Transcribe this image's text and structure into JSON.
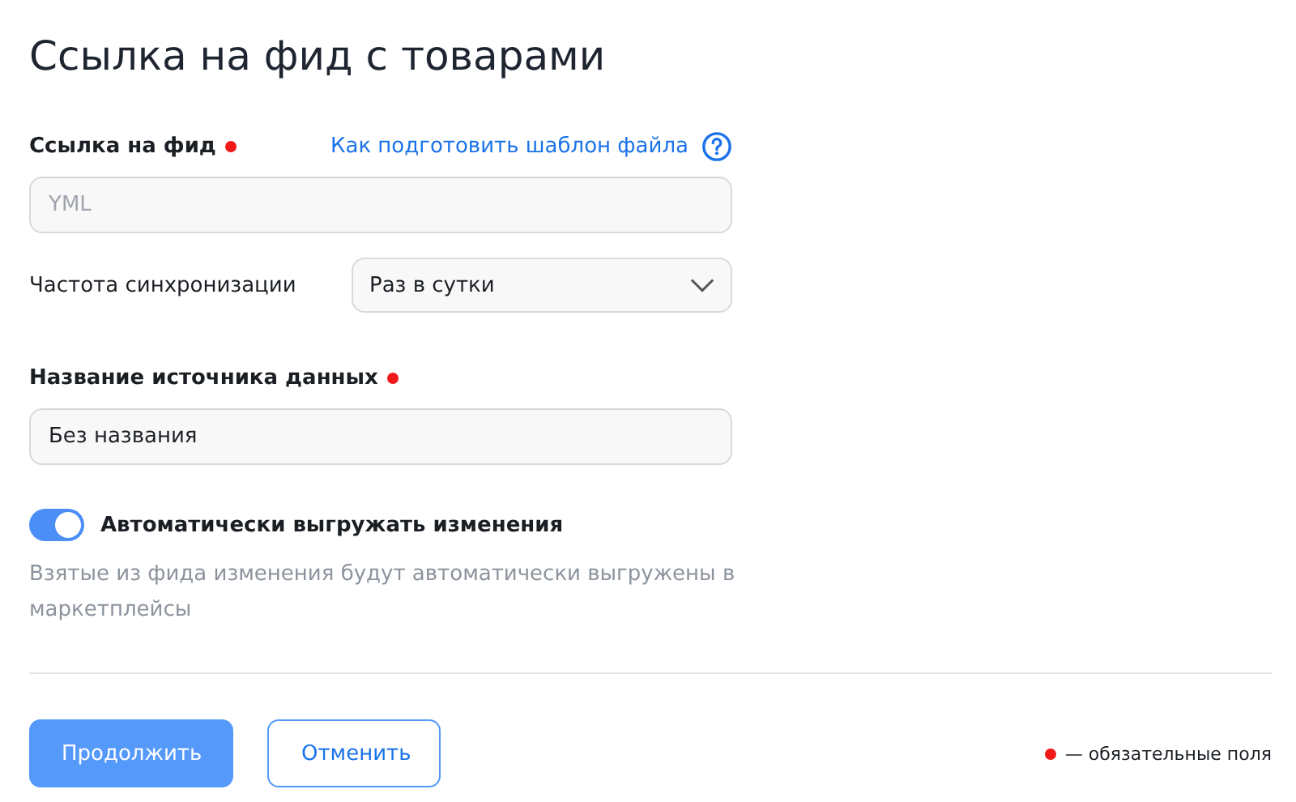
{
  "title": "Ссылка на фид с товарами",
  "feed_link": {
    "label": "Ссылка на фид",
    "required": true,
    "help_link": "Как подготовить шаблон файла",
    "placeholder": "YML"
  },
  "sync": {
    "label": "Частота синхронизации",
    "value": "Раз в сутки"
  },
  "source_name": {
    "label": "Название источника данных",
    "required": true,
    "value": "Без названия"
  },
  "auto_upload": {
    "label": "Автоматически выгружать изменения",
    "on": true,
    "description": "Взятые из фида изменения будут автоматически выгружены в маркетплейсы"
  },
  "buttons": [
    {
      "label": "Продолжить",
      "kind": "primary"
    },
    {
      "label": "Отменить",
      "kind": "secondary"
    }
  ],
  "legend": "— обязательные поля"
}
